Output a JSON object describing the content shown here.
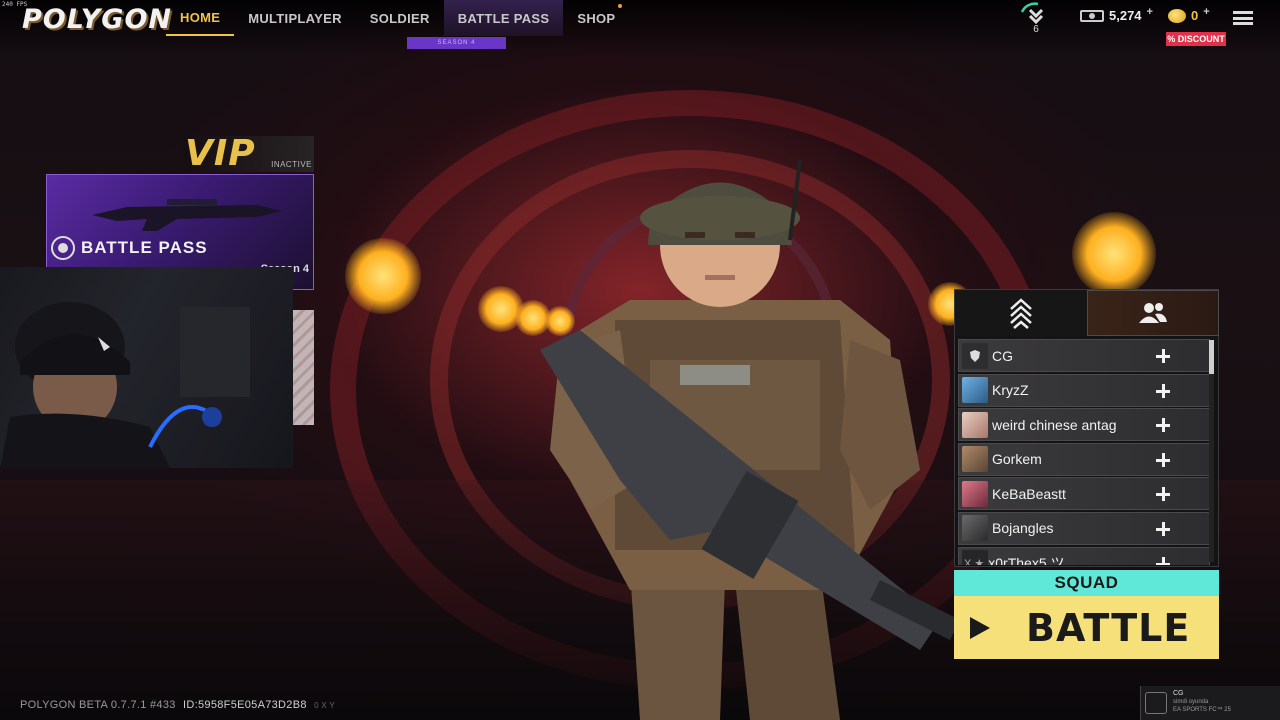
{
  "overlay": {
    "fps": "240 FPS"
  },
  "header": {
    "logo": "POLYGON",
    "nav": [
      {
        "label": "HOME",
        "active": true
      },
      {
        "label": "MULTIPLAYER",
        "active": false
      },
      {
        "label": "SOLDIER",
        "active": false
      },
      {
        "label": "BATTLE PASS",
        "active": false
      },
      {
        "label": "SHOP",
        "active": false
      }
    ],
    "battle_pass_season_tag": "SEASON 4",
    "rank_level": "6",
    "cash": "5,274",
    "coins": "0",
    "plus": "+",
    "discount": "% DISCOUNT",
    "colors": {
      "accent": "#f0c545",
      "discount": "#e2304a",
      "season": "#6a36c8"
    }
  },
  "vip": {
    "label": "VIP",
    "status": "INACTIVE"
  },
  "battle_pass_card": {
    "title": "BATTLE PASS",
    "season": "Season 4"
  },
  "friends_panel": {
    "tabs": [
      {
        "icon": "rank-chevrons-icon"
      },
      {
        "icon": "friends-icon",
        "active": true
      }
    ],
    "friends": [
      {
        "name": "CG",
        "avatar": "#3a3a3a"
      },
      {
        "name": "KryzZ",
        "avatar": "#4a86b8"
      },
      {
        "name": "weird chinese antag",
        "avatar": "#c9a79c"
      },
      {
        "name": "Gorkem",
        "avatar": "#8a6b52"
      },
      {
        "name": "KeBaBeastt",
        "avatar": "#b84a5a"
      },
      {
        "name": "Bojangles",
        "avatar": "#4a4a4a"
      },
      {
        "name": "x0rThex5 ツ",
        "avatar": "#2a2a2a",
        "prefix": "X ★"
      }
    ],
    "squad_label": "SQUAD",
    "battle_label": "BATTLE",
    "colors": {
      "squad": "#5fe8d8",
      "battle": "#f6e07a"
    }
  },
  "footer": {
    "version": "POLYGON BETA 0.7.7.1 #433",
    "id": "ID:5958F5E05A73D2B8",
    "flags": "0 X Y"
  },
  "profile_mini": {
    "name": "CG",
    "sub": "simdi oyunda",
    "club": "EA SPORTS FC™ 25"
  }
}
